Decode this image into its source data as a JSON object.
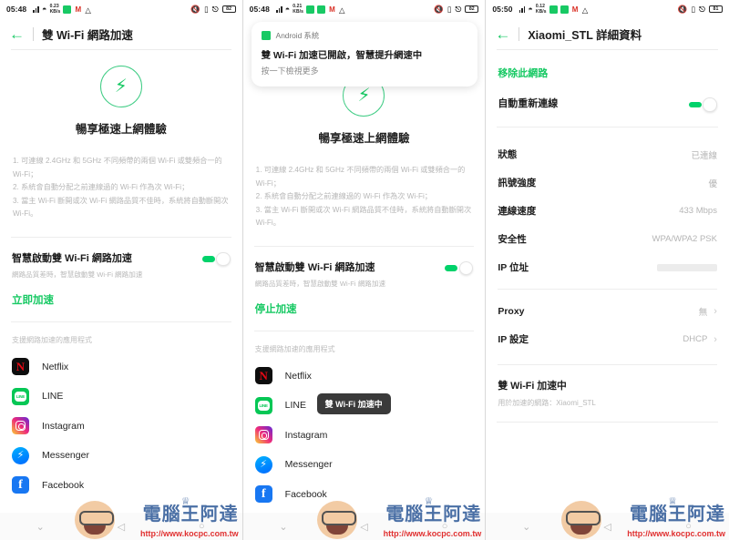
{
  "status_bar": {
    "time_1": "05:48",
    "time_2": "05:48",
    "time_3": "05:50",
    "battery_1": "82",
    "battery_2": "82",
    "battery_3": "81",
    "mail_icon_letter": "M"
  },
  "panel1": {
    "app_title": "雙 Wi-Fi 網路加速",
    "back_icon": "back-arrow",
    "hero_icon": "lightning-bolt-icon",
    "hero_title": "暢享極速上網體驗",
    "tips": "1. 可連線 2.4GHz 和 5GHz 不同頻帶的兩個 Wi-Fi 或雙頻合一的 Wi-Fi；\n2. 系統會自動分配之前連線過的 Wi-Fi 作為次 Wi-Fi；\n3. 當主 Wi-Fi 斷開或次 Wi-Fi 網路品質不佳時，系統將自動斷開次 Wi-Fi。",
    "toggle_title": "智慧啟動雙 Wi-Fi 網路加速",
    "toggle_sub": "網路品質差時，智慧啟動雙 Wi-Fi 網路加速",
    "action_label": "立即加速",
    "apps_section_label": "支援網路加速的應用程式",
    "apps": [
      {
        "name": "Netflix",
        "icon": "netflix-icon"
      },
      {
        "name": "LINE",
        "icon": "line-icon"
      },
      {
        "name": "Instagram",
        "icon": "instagram-icon"
      },
      {
        "name": "Messenger",
        "icon": "messenger-icon"
      },
      {
        "name": "Facebook",
        "icon": "facebook-icon"
      }
    ]
  },
  "panel2": {
    "notification": {
      "app_name": "Android 系統",
      "title": "雙 Wi-Fi 加速已開啟，智慧提升網速中",
      "subtitle": "按一下檢視更多",
      "app_icon": "android-system-icon"
    },
    "hero_icon": "lightning-bolt-icon",
    "hero_title": "暢享極速上網體驗",
    "tips": "1. 可連線 2.4GHz 和 5GHz 不同頻帶的兩個 Wi-Fi 或雙頻合一的 Wi-Fi；\n2. 系統會自動分配之前連線過的 Wi-Fi 作為次 Wi-Fi；\n3. 當主 Wi-Fi 斷開或次 Wi-Fi 網路品質不佳時，系統將自動斷開次 Wi-Fi。",
    "toggle_title": "智慧啟動雙 Wi-Fi 網路加速",
    "toggle_sub": "網路品質差時，智慧啟動雙 Wi-Fi 網路加速",
    "action_label": "停止加速",
    "apps_section_label": "支援網路加速的應用程式",
    "tooltip": "雙 Wi-Fi 加速中",
    "apps": [
      {
        "name": "Netflix",
        "icon": "netflix-icon"
      },
      {
        "name": "LINE",
        "icon": "line-icon"
      },
      {
        "name": "Instagram",
        "icon": "instagram-icon"
      },
      {
        "name": "Messenger",
        "icon": "messenger-icon"
      },
      {
        "name": "Facebook",
        "icon": "facebook-icon"
      }
    ]
  },
  "panel3": {
    "app_title": "Xiaomi_STL 詳細資料",
    "remove_network": "移除此網路",
    "auto_reconnect_label": "自動重新連線",
    "details": [
      {
        "key": "狀態",
        "value": "已連線",
        "chevron": false,
        "blurred": false
      },
      {
        "key": "訊號強度",
        "value": "優",
        "chevron": false,
        "blurred": false
      },
      {
        "key": "連線速度",
        "value": "433 Mbps",
        "chevron": false,
        "blurred": false
      },
      {
        "key": "安全性",
        "value": "WPA/WPA2 PSK",
        "chevron": false,
        "blurred": false
      },
      {
        "key": "IP 位址",
        "value": "",
        "chevron": false,
        "blurred": true
      }
    ],
    "settings": [
      {
        "key": "Proxy",
        "value": "無",
        "chevron": true,
        "blurred": false
      },
      {
        "key": "IP 設定",
        "value": "DHCP",
        "chevron": true,
        "blurred": false
      }
    ],
    "accel_title": "雙 Wi-Fi 加速中",
    "accel_sub": "用於加速的網路：Xiaomi_STL"
  },
  "navbar": {
    "recents": "⌄",
    "back": "◁",
    "home": "○"
  },
  "watermark": {
    "brand": "電腦王阿達",
    "url": "http://www.kocpc.com.tw"
  },
  "colors": {
    "accent_green": "#18c964",
    "toggle_green": "#00d26a",
    "muted": "#b9b9b9"
  }
}
